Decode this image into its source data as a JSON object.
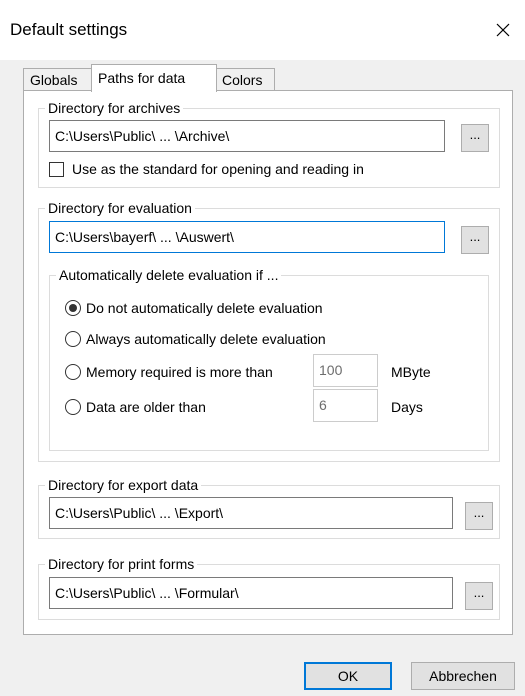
{
  "window": {
    "title": "Default settings",
    "close_icon": "close-icon"
  },
  "tabs": [
    {
      "label": "Globals",
      "active": false
    },
    {
      "label": "Paths for data",
      "active": true
    },
    {
      "label": "Colors",
      "active": false
    }
  ],
  "archives": {
    "legend": "Directory for archives",
    "path": "C:\\Users\\Public\\ ... \\Archive\\",
    "browse": "...",
    "checkbox_label": "Use as the standard for opening and reading in",
    "checked": false
  },
  "evaluation": {
    "legend": "Directory for evaluation",
    "path": "C:\\Users\\bayerf\\ ... \\Auswert\\",
    "browse": "...",
    "auto_delete": {
      "legend": "Automatically delete evaluation if ...",
      "options": [
        {
          "label": "Do not automatically delete evaluation",
          "selected": true
        },
        {
          "label": "Always automatically delete evaluation",
          "selected": false
        },
        {
          "label": "Memory required is more than",
          "value": "100",
          "unit": "MByte",
          "selected": false
        },
        {
          "label": "Data are older than",
          "value": "6",
          "unit": "Days",
          "selected": false
        }
      ]
    }
  },
  "export": {
    "legend": "Directory for export data",
    "path": "C:\\Users\\Public\\ ... \\Export\\",
    "browse": "..."
  },
  "print_forms": {
    "legend": "Directory for print forms",
    "path": "C:\\Users\\Public\\ ... \\Formular\\",
    "browse": "..."
  },
  "buttons": {
    "ok": "OK",
    "cancel": "Abbrechen"
  }
}
